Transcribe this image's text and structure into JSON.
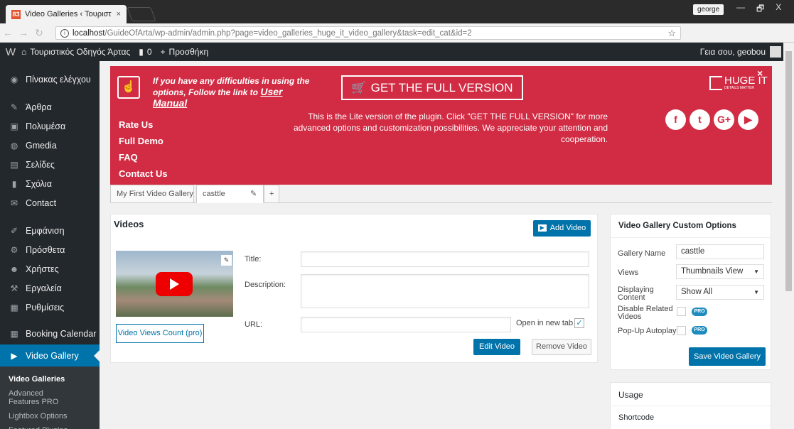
{
  "browser": {
    "tab_title": "Video Galleries ‹ Τουριστ",
    "tab_close": "×",
    "favicon": "83",
    "user_chip": "george",
    "win_min": "—",
    "win_max": "🗗",
    "win_close": "X",
    "url_host": "localhost",
    "url_path": "/GuideOfArta/wp-admin/admin.php?page=video_galleries_huge_it_video_gallery&task=edit_cat&id=2",
    "star": "☆"
  },
  "adminbar": {
    "wp_icon": "W",
    "site_name": "Τουριστικός Οδηγός Άρτας",
    "comments_count": "0",
    "new_label": "Προσθήκη",
    "greeting": "Γεια σου, geobou"
  },
  "sidebar": {
    "items": [
      {
        "label": "Πίνακας ελέγχου",
        "icon": "dashboard-icon",
        "glyph": "◉"
      },
      {
        "label": "Άρθρα",
        "icon": "pin-icon",
        "glyph": "✎"
      },
      {
        "label": "Πολυμέσα",
        "icon": "media-icon",
        "glyph": "▣"
      },
      {
        "label": "Gmedia",
        "icon": "gmedia-icon",
        "glyph": "◍"
      },
      {
        "label": "Σελίδες",
        "icon": "pages-icon",
        "glyph": "▤"
      },
      {
        "label": "Σχόλια",
        "icon": "comments-icon",
        "glyph": "▮"
      },
      {
        "label": "Contact",
        "icon": "mail-icon",
        "glyph": "✉"
      },
      {
        "label": "Εμφάνιση",
        "icon": "brush-icon",
        "glyph": "✐"
      },
      {
        "label": "Πρόσθετα",
        "icon": "plugin-icon",
        "glyph": "⚙"
      },
      {
        "label": "Χρήστες",
        "icon": "users-icon",
        "glyph": "☻"
      },
      {
        "label": "Εργαλεία",
        "icon": "wrench-icon",
        "glyph": "⚒"
      },
      {
        "label": "Ρυθμίσεις",
        "icon": "settings-icon",
        "glyph": "▦"
      },
      {
        "label": "Booking Calendar",
        "icon": "calendar-icon",
        "glyph": "▦"
      },
      {
        "label": "Video Gallery",
        "icon": "video-icon",
        "glyph": "▶"
      }
    ],
    "submenu": [
      "Video Galleries",
      "Advanced Features PRO",
      "Lightbox Options",
      "Featured Plugins"
    ]
  },
  "banner": {
    "help_line1": "If you have any difficulties in using the",
    "help_line2": "options, Follow the link to",
    "manual_link": "User Manual",
    "full_version": "GET THE FULL VERSION",
    "lite_text": "This is the Lite version of the plugin. Click \"GET THE FULL VERSION\" for more advanced options and customization possibilities. We appreciate your attention and cooperation.",
    "links": [
      "Rate Us",
      "Full Demo",
      "FAQ",
      "Contact Us"
    ],
    "logo_title": "HUGE IT",
    "logo_tagline": "DETAILS MATTER",
    "close": "×",
    "social": [
      "f",
      "t",
      "G+",
      "▶"
    ],
    "bg_color": "#d12c44"
  },
  "gallery_tabs": {
    "tab1": "My First Video Gallery",
    "tab2": "casttle",
    "edit": "✎",
    "add": "+"
  },
  "videos": {
    "header": "Videos",
    "add_button": "Add Video",
    "views_count": "Video Views Count (pro)",
    "title_label": "Title:",
    "description_label": "Description:",
    "url_label": "URL:",
    "new_tab_label": "Open in new tab",
    "new_tab_checked": "✓",
    "edit_button": "Edit Video",
    "remove_button": "Remove Video"
  },
  "custom_options": {
    "header": "Video Gallery Custom Options",
    "gallery_name_label": "Gallery Name",
    "gallery_name_value": "casttle",
    "views_label": "Views",
    "views_value": "Thumbnails View",
    "displaying_label": "Displaying Content",
    "displaying_value": "Show All",
    "disable_related_label": "Disable Related Videos",
    "popup_autoplay_label": "Pop-Up Autoplay",
    "pro_badge": "PRO",
    "save_button": "Save Video Gallery"
  },
  "usage": {
    "header": "Usage",
    "shortcode_label": "Shortcode"
  }
}
